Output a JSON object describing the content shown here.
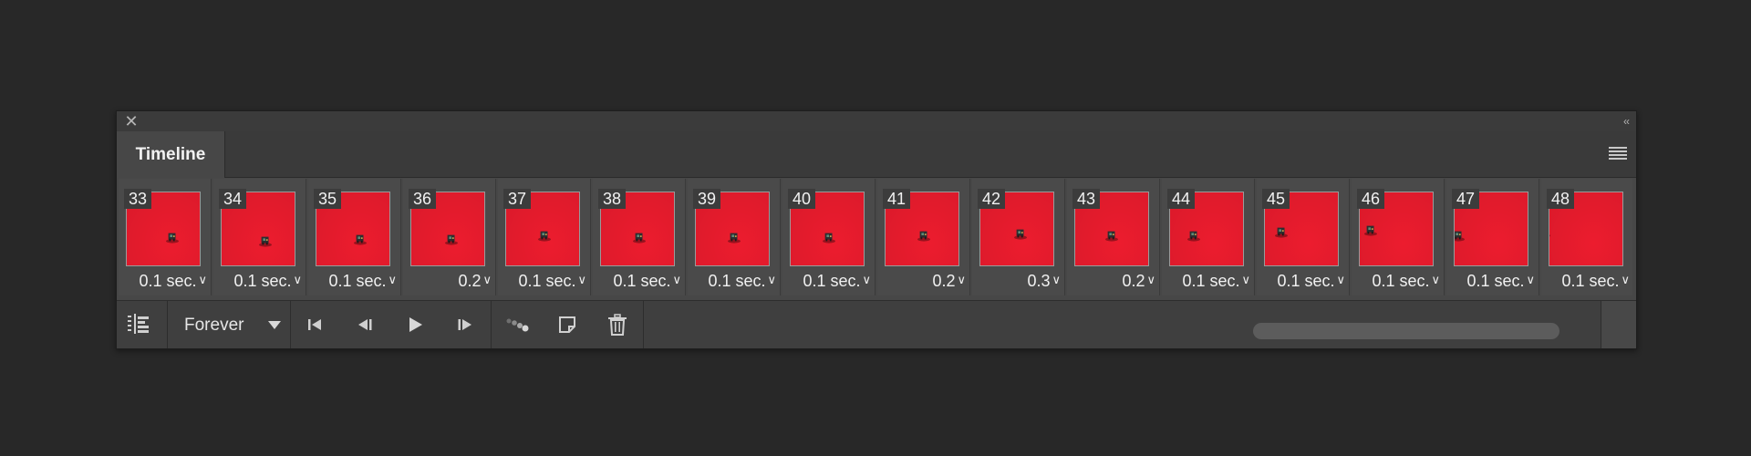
{
  "window": {
    "close_icon": "close-icon",
    "collapse_icon": "collapse-icon"
  },
  "panel": {
    "tab_label": "Timeline",
    "menu_icon": "panel-menu-icon"
  },
  "frames": [
    {
      "number": "33",
      "delay": "0.1 sec."
    },
    {
      "number": "34",
      "delay": "0.1 sec."
    },
    {
      "number": "35",
      "delay": "0.1 sec."
    },
    {
      "number": "36",
      "delay": "0.2"
    },
    {
      "number": "37",
      "delay": "0.1 sec."
    },
    {
      "number": "38",
      "delay": "0.1 sec."
    },
    {
      "number": "39",
      "delay": "0.1 sec."
    },
    {
      "number": "40",
      "delay": "0.1 sec."
    },
    {
      "number": "41",
      "delay": "0.2"
    },
    {
      "number": "42",
      "delay": "0.3"
    },
    {
      "number": "43",
      "delay": "0.2"
    },
    {
      "number": "44",
      "delay": "0.1 sec."
    },
    {
      "number": "45",
      "delay": "0.1 sec."
    },
    {
      "number": "46",
      "delay": "0.1 sec."
    },
    {
      "number": "47",
      "delay": "0.1 sec."
    },
    {
      "number": "48",
      "delay": "0.1 sec."
    }
  ],
  "controls": {
    "convert_icon": "convert-to-video-timeline-icon",
    "loop_value": "Forever",
    "first_frame_icon": "select-first-frame-icon",
    "prev_frame_icon": "select-previous-frame-icon",
    "play_icon": "play-icon",
    "next_frame_icon": "select-next-frame-icon",
    "tween_icon": "tween-icon",
    "duplicate_icon": "duplicate-frame-icon",
    "delete_icon": "trash-icon"
  },
  "colors": {
    "frame_background": "#ec1c2e",
    "panel": "#474747",
    "app_background": "#282828"
  }
}
